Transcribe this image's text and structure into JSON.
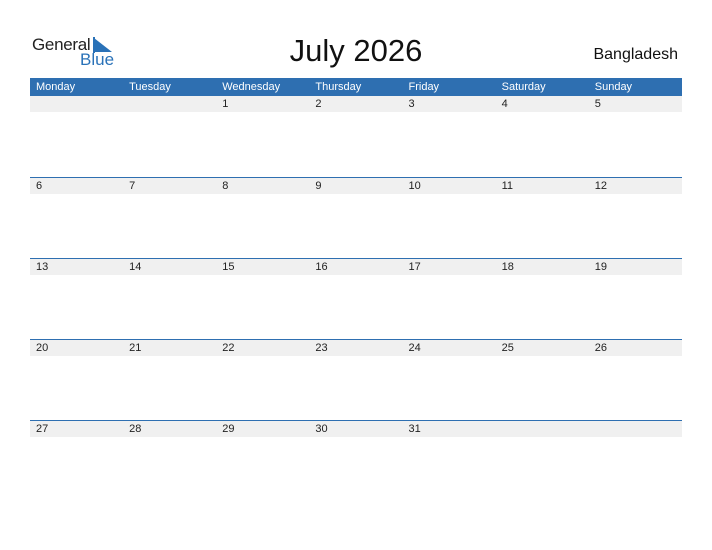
{
  "logo": {
    "general": "General",
    "blue": "Blue"
  },
  "title": "July 2026",
  "country": "Bangladesh",
  "weekdays": [
    "Monday",
    "Tuesday",
    "Wednesday",
    "Thursday",
    "Friday",
    "Saturday",
    "Sunday"
  ],
  "weeks": [
    [
      "",
      "",
      "1",
      "2",
      "3",
      "4",
      "5"
    ],
    [
      "6",
      "7",
      "8",
      "9",
      "10",
      "11",
      "12"
    ],
    [
      "13",
      "14",
      "15",
      "16",
      "17",
      "18",
      "19"
    ],
    [
      "20",
      "21",
      "22",
      "23",
      "24",
      "25",
      "26"
    ],
    [
      "27",
      "28",
      "29",
      "30",
      "31",
      "",
      ""
    ]
  ],
  "colors": {
    "accent": "#2e6fb1",
    "strip": "#f0f0f0"
  }
}
